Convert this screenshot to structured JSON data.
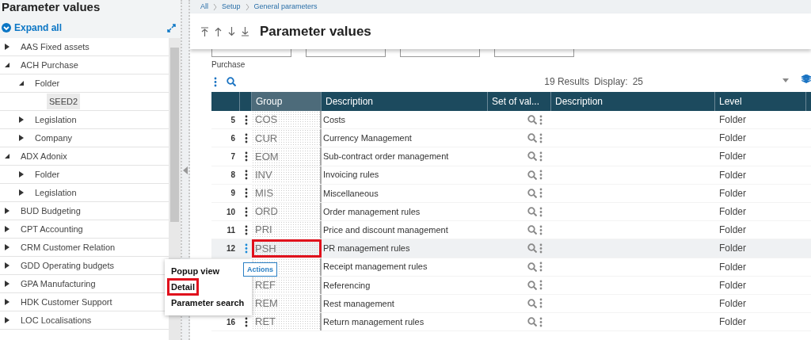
{
  "panel": {
    "title": "Parameter values",
    "expand_all": "Expand all",
    "tree": [
      {
        "label": "AAS Fixed assets",
        "expanded": false,
        "selected": false
      },
      {
        "label": "ACH Purchase",
        "expanded": true,
        "selected": false,
        "children": [
          {
            "label": "Folder",
            "expanded": true,
            "selected": false,
            "children": [
              {
                "label": "SEED2",
                "selected": true
              }
            ]
          },
          {
            "label": "Legislation",
            "expanded": false,
            "selected": false
          },
          {
            "label": "Company",
            "expanded": false,
            "selected": false
          }
        ]
      },
      {
        "label": "ADX Adonix",
        "expanded": true,
        "selected": false,
        "children": [
          {
            "label": "Folder",
            "expanded": false,
            "selected": false
          },
          {
            "label": "Legislation",
            "expanded": false,
            "selected": false
          }
        ]
      },
      {
        "label": "BUD Budgeting",
        "expanded": false,
        "selected": false
      },
      {
        "label": "CPT Accounting",
        "expanded": false,
        "selected": false
      },
      {
        "label": "CRM Customer Relation",
        "expanded": false,
        "selected": false
      },
      {
        "label": "GDD Operating budgets",
        "expanded": false,
        "selected": false
      },
      {
        "label": "GPA Manufacturing",
        "expanded": false,
        "selected": false
      },
      {
        "label": "HDK Customer Support",
        "expanded": false,
        "selected": false
      },
      {
        "label": "LOC Localisations",
        "expanded": false,
        "selected": false
      }
    ]
  },
  "breadcrumb": [
    "All",
    "Setup",
    "General parameters"
  ],
  "header": {
    "title": "Parameter values"
  },
  "filter": {
    "label": "Purchase"
  },
  "toolbar": {
    "results": "19 Results",
    "display_label": "Display:",
    "display_value": "25"
  },
  "table": {
    "columns": [
      "Group",
      "Description",
      "Set of val...",
      "Description",
      "Level"
    ],
    "rows": [
      {
        "number": "5",
        "group": "COS",
        "description": "Costs",
        "level": "Folder",
        "selected": false,
        "highlighted": false
      },
      {
        "number": "6",
        "group": "CUR",
        "description": "Currency Management",
        "level": "Folder",
        "selected": false,
        "highlighted": false
      },
      {
        "number": "7",
        "group": "EOM",
        "description": "Sub-contract order management",
        "level": "Folder",
        "selected": false,
        "highlighted": false
      },
      {
        "number": "8",
        "group": "INV",
        "description": "Invoicing rules",
        "level": "Folder",
        "selected": false,
        "highlighted": false
      },
      {
        "number": "9",
        "group": "MIS",
        "description": "Miscellaneous",
        "level": "Folder",
        "selected": false,
        "highlighted": false
      },
      {
        "number": "10",
        "group": "ORD",
        "description": "Order management rules",
        "level": "Folder",
        "selected": false,
        "highlighted": false
      },
      {
        "number": "11",
        "group": "PRI",
        "description": "Price and discount management",
        "level": "Folder",
        "selected": false,
        "highlighted": false
      },
      {
        "number": "12",
        "group": "PSH",
        "description": "PR management rules",
        "level": "Folder",
        "selected": true,
        "highlighted": true
      },
      {
        "description": "Receipt management rules",
        "level": "Folder",
        "selected": false,
        "highlighted": false
      },
      {
        "group": "REF",
        "description": "Referencing",
        "level": "Folder",
        "selected": false,
        "highlighted": false
      },
      {
        "group": "REM",
        "description": "Rest management",
        "level": "Folder",
        "selected": false,
        "highlighted": false
      },
      {
        "number": "16",
        "group": "RET",
        "description": "Return management rules",
        "level": "Folder",
        "selected": false,
        "highlighted": false
      }
    ]
  },
  "context_menu": {
    "items": [
      {
        "label": "Popup view",
        "highlighted": false
      },
      {
        "label": "Detail",
        "highlighted": true
      },
      {
        "label": "Parameter search",
        "highlighted": false
      }
    ]
  },
  "tooltip": "Actions"
}
